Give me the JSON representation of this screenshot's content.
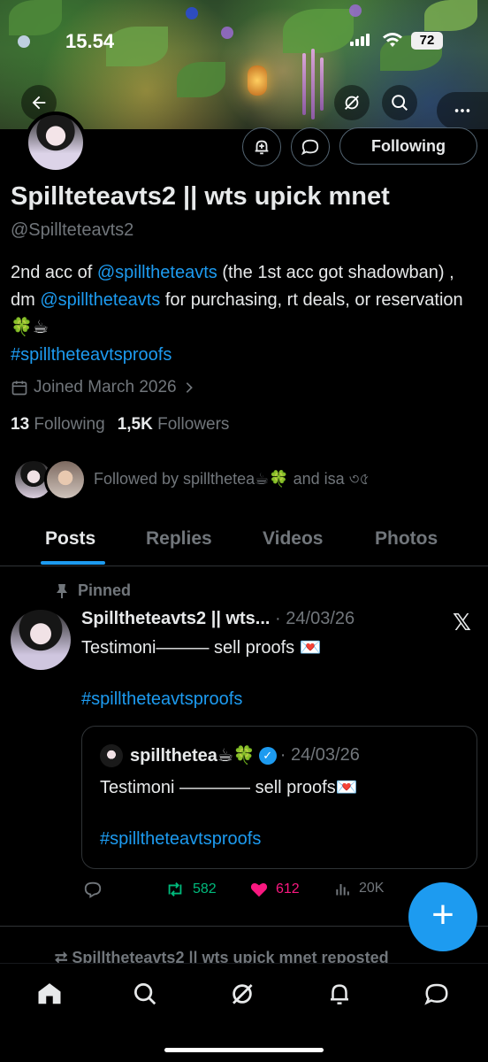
{
  "status_bar": {
    "time": "15.54",
    "battery": "72"
  },
  "profile": {
    "follow_button": "Following",
    "display_name": "Spillteteavts2 || wts upick mnet",
    "handle": "@Spillteteavts2",
    "bio": {
      "part1": "2nd acc of ",
      "mention1": "@spilltheteavts",
      "part2": " (the 1st acc got shadowban) , dm ",
      "mention2": "@spilltheteavts",
      "part3": " for purchasing, rt deals, or reservation 🍀☕",
      "hashtag": "#spilltheteavtsproofs"
    },
    "joined": "Joined March 2026",
    "following_count": "13",
    "following_label": "Following",
    "followers_count": "1,5K",
    "followers_label": "Followers",
    "followed_by": "Followed by spillthetea☕🍀 and isa ৩৫"
  },
  "tabs": [
    "Posts",
    "Replies",
    "Videos",
    "Photos"
  ],
  "post": {
    "pinned_label": "Pinned",
    "author": "Spilltheteavts2 || wts...",
    "date": "· 24/03/26",
    "text": "Testimoni——— sell proofs 💌",
    "hashtag": "#spilltheteavtsproofs",
    "quote": {
      "author": "spillthetea☕🍀",
      "date": "· 24/03/26",
      "text": "Testimoni ———— sell proofs💌",
      "hashtag": "#spilltheteavtsproofs"
    },
    "retweets": "582",
    "likes": "612",
    "views": "20K"
  },
  "next_item": {
    "reposted_label": "Spilltheteavts2 || wts upick mnet reposted"
  },
  "colors": {
    "accent": "#1d9bf0",
    "retweet": "#00ba7c",
    "like": "#f91880",
    "muted": "#71767b"
  }
}
